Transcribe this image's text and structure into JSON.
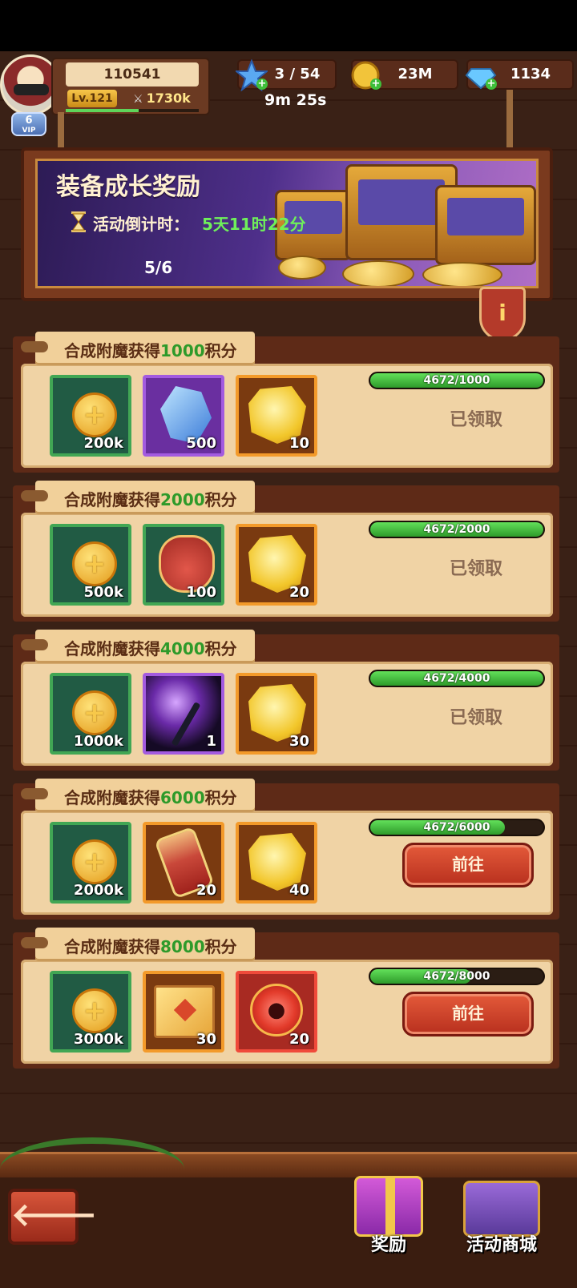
{
  "header": {
    "player_id": "110541",
    "level": "Lv.121",
    "power": "1730k",
    "vip": {
      "level": "6",
      "label": "VIP"
    },
    "resources": {
      "energy": "3 / 54",
      "gold": "23M",
      "gems": "1134"
    },
    "energy_timer": "9m 25s"
  },
  "banner": {
    "title": "装备成长奖励",
    "countdown_label": "活动倒计时：",
    "countdown_value": "5天11时22分",
    "page": "5/6",
    "info_icon": "i"
  },
  "tasks": [
    {
      "title_prefix": "合成附魔获得",
      "title_value": "1000",
      "title_suffix": "积分",
      "rewards": [
        {
          "icon": "gold-coin-icon",
          "qty": "200k"
        },
        {
          "icon": "blue-crystal-icon",
          "qty": "500"
        },
        {
          "icon": "gold-ore-icon",
          "qty": "10"
        }
      ],
      "progress_text": "4672/1000",
      "progress": 1.0,
      "status": "已领取"
    },
    {
      "title_prefix": "合成附魔获得",
      "title_value": "2000",
      "title_suffix": "积分",
      "rewards": [
        {
          "icon": "gold-coin-icon",
          "qty": "500k"
        },
        {
          "icon": "red-bag-icon",
          "qty": "100"
        },
        {
          "icon": "gold-ore-icon",
          "qty": "20"
        }
      ],
      "progress_text": "4672/2000",
      "progress": 1.0,
      "status": "已领取"
    },
    {
      "title_prefix": "合成附魔获得",
      "title_value": "4000",
      "title_suffix": "积分",
      "rewards": [
        {
          "icon": "gold-coin-icon",
          "qty": "1000k"
        },
        {
          "icon": "magic-staff-icon",
          "qty": "1"
        },
        {
          "icon": "gold-ore-icon",
          "qty": "30"
        }
      ],
      "progress_text": "4672/4000",
      "progress": 1.0,
      "status": "已领取"
    },
    {
      "title_prefix": "合成附魔获得",
      "title_value": "6000",
      "title_suffix": "积分",
      "rewards": [
        {
          "icon": "gold-coin-icon",
          "qty": "2000k"
        },
        {
          "icon": "rose-scroll-icon",
          "qty": "20"
        },
        {
          "icon": "gold-ore-icon",
          "qty": "40"
        }
      ],
      "progress_text": "4672/6000",
      "progress": 0.779,
      "button": "前往"
    },
    {
      "title_prefix": "合成附魔获得",
      "title_value": "8000",
      "title_suffix": "积分",
      "rewards": [
        {
          "icon": "gold-coin-icon",
          "qty": "3000k"
        },
        {
          "icon": "spell-book-icon",
          "qty": "30"
        },
        {
          "icon": "paw-token-icon",
          "qty": "20"
        }
      ],
      "progress_text": "4672/8000",
      "progress": 0.584,
      "button": "前往"
    }
  ],
  "footer": {
    "back_icon": "🡐",
    "rewards_label": "奖励",
    "shop_label": "活动商城"
  }
}
